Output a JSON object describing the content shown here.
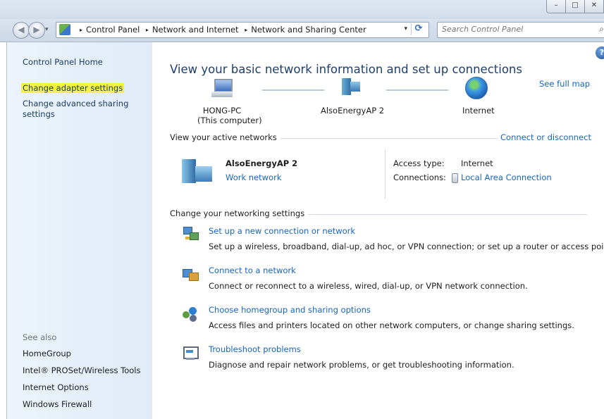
{
  "window": {
    "minimize": "–",
    "maximize": "□",
    "close": "✕"
  },
  "nav": {
    "back_glyph": "◀",
    "forward_glyph": "▶",
    "recent_glyph": "▾",
    "breadcrumbs": [
      "Control Panel",
      "Network and Internet",
      "Network and Sharing Center"
    ],
    "crumb_separator": "▸",
    "address_dropdown": "▾",
    "refresh_glyph": "⟳",
    "search_placeholder": "Search Control Panel",
    "search_glyph": "⌕"
  },
  "sidebar": {
    "home": "Control Panel Home",
    "adapter": "Change adapter settings",
    "advanced_sharing": "Change advanced sharing settings",
    "see_also": "See also",
    "see_also_items": [
      "HomeGroup",
      "Intel® PROSet/Wireless Tools",
      "Internet Options",
      "Windows Firewall"
    ],
    "highlight_color": "#f6f346"
  },
  "main": {
    "title": "View your basic network information and set up connections",
    "help_glyph": "?",
    "see_full_map": "See full map",
    "map": {
      "computer_name": "HONG-PC",
      "computer_sub": "(This computer)",
      "network": "AlsoEnergyAP  2",
      "internet": "Internet"
    },
    "active_networks": {
      "label": "View your active networks",
      "connect_link": "Connect or disconnect",
      "name": "AlsoEnergyAP  2",
      "type": "Work network",
      "access_label": "Access type:",
      "access_value": "Internet",
      "connections_label": "Connections:",
      "connections_value": "Local Area Connection"
    },
    "settings": {
      "label": "Change your networking settings",
      "tasks": [
        {
          "icon": "new-connection-icon",
          "title": "Set up a new connection or network",
          "desc": "Set up a wireless, broadband, dial-up, ad hoc, or VPN connection; or set up a router or access point."
        },
        {
          "icon": "connect-network-icon",
          "title": "Connect to a network",
          "desc": "Connect or reconnect to a wireless, wired, dial-up, or VPN network connection."
        },
        {
          "icon": "homegroup-icon",
          "title": "Choose homegroup and sharing options",
          "desc": "Access files and printers located on other network computers, or change sharing settings."
        },
        {
          "icon": "troubleshoot-icon",
          "title": "Troubleshoot problems",
          "desc": "Diagnose and repair network problems, or get troubleshooting information."
        }
      ]
    },
    "link_color": "#1565c0",
    "title_color": "#1e3f6b"
  }
}
